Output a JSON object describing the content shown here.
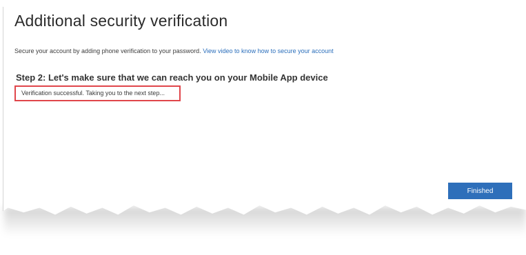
{
  "page": {
    "title": "Additional security verification",
    "subtitle_text": "Secure your account by adding phone verification to your password.",
    "subtitle_link": "View video to know how to secure your account",
    "step_heading": "Step 2: Let's make sure that we can reach you on your Mobile App device",
    "status_message": "Verification successful. Taking you to the next step...",
    "finished_label": "Finished"
  },
  "colors": {
    "accent": "#2e6fba",
    "link": "#2a6ebb",
    "highlight_border": "#e0454a"
  }
}
